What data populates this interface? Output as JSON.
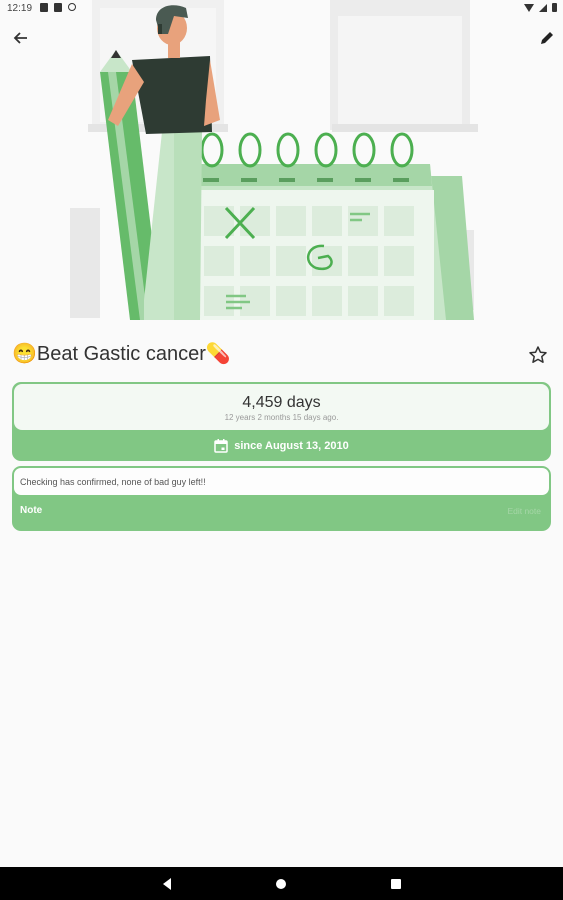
{
  "status_bar": {
    "time": "12:19"
  },
  "goal": {
    "title": "😁Beat Gastic cancer💊",
    "days_count": "4,459 days",
    "days_detail": "12 years 2 months 15 days ago.",
    "since": "since August 13, 2010"
  },
  "note": {
    "text": "Checking has confirmed, none of bad guy left!!",
    "label": "Note",
    "edit_label": "Edit note"
  },
  "colors": {
    "accent": "#81c784",
    "accent_light": "#a5d6a7",
    "illustration_green": "#4caf50"
  }
}
